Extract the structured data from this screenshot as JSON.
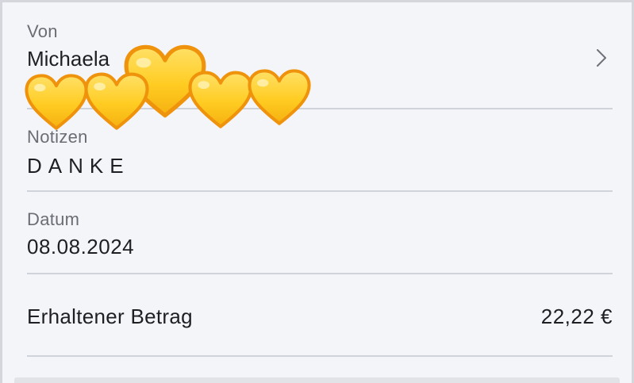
{
  "details": {
    "from": {
      "label": "Von",
      "name": "Michaela"
    },
    "notes": {
      "label": "Notizen",
      "text": "DANKE"
    },
    "date": {
      "label": "Datum",
      "value": "08.08.2024"
    },
    "amount": {
      "label": "Erhaltener Betrag",
      "value": "22,22 €"
    }
  },
  "icons": {
    "chevron": "chevron-right-icon",
    "overlay": "yellow-heart-emoji"
  },
  "colors": {
    "background": "#f4f5f9",
    "text": "#1e1f24",
    "label": "#6b6d75",
    "divider": "#d0d3d9",
    "heart_fill": "#ffcc33",
    "heart_outline": "#f0960c"
  }
}
